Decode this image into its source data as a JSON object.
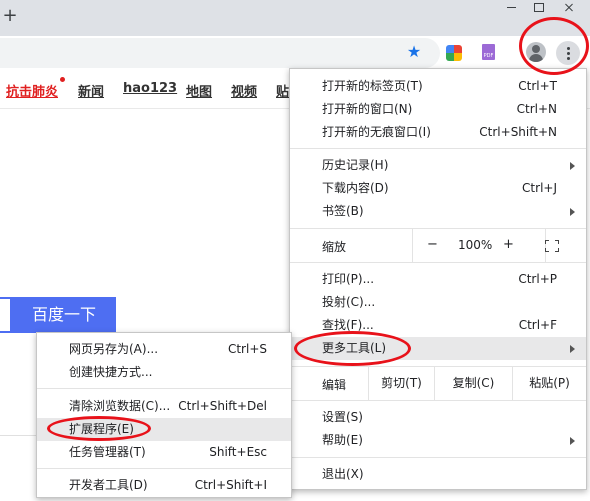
{
  "browser": {
    "new_tab_glyph": "+",
    "star_glyph": "★",
    "ext_pdf_label": "PDF"
  },
  "page": {
    "nav_links": [
      "抗击肺炎",
      "新闻",
      "hao123",
      "地图",
      "视频",
      "贴"
    ],
    "search_button_label": "百度一下"
  },
  "main_menu": {
    "new_tab": {
      "label": "打开新的标签页(T)",
      "shortcut": "Ctrl+T"
    },
    "new_window": {
      "label": "打开新的窗口(N)",
      "shortcut": "Ctrl+N"
    },
    "incognito": {
      "label": "打开新的无痕窗口(I)",
      "shortcut": "Ctrl+Shift+N"
    },
    "history": {
      "label": "历史记录(H)"
    },
    "downloads": {
      "label": "下载内容(D)",
      "shortcut": "Ctrl+J"
    },
    "bookmarks": {
      "label": "书签(B)"
    },
    "zoom": {
      "label": "缩放",
      "minus": "−",
      "value": "100%",
      "plus": "+"
    },
    "print": {
      "label": "打印(P)...",
      "shortcut": "Ctrl+P"
    },
    "cast": {
      "label": "投射(C)..."
    },
    "find": {
      "label": "查找(F)...",
      "shortcut": "Ctrl+F"
    },
    "more_tools": {
      "label": "更多工具(L)"
    },
    "edit": {
      "label": "编辑",
      "cut": "剪切(T)",
      "copy": "复制(C)",
      "paste": "粘贴(P)"
    },
    "settings": {
      "label": "设置(S)"
    },
    "help": {
      "label": "帮助(E)"
    },
    "exit": {
      "label": "退出(X)"
    }
  },
  "sub_menu": {
    "save_page": {
      "label": "网页另存为(A)...",
      "shortcut": "Ctrl+S"
    },
    "create_shortcut": {
      "label": "创建快捷方式..."
    },
    "clear_data": {
      "label": "清除浏览数据(C)...",
      "shortcut": "Ctrl+Shift+Del"
    },
    "extensions": {
      "label": "扩展程序(E)"
    },
    "task_manager": {
      "label": "任务管理器(T)",
      "shortcut": "Shift+Esc"
    },
    "dev_tools": {
      "label": "开发者工具(D)",
      "shortcut": "Ctrl+Shift+I"
    }
  },
  "colors": {
    "accent": "#1a73e8",
    "search_button": "#4e6ef2",
    "annotation": "#e8121a",
    "highlight_row": "#e8e8e9"
  }
}
